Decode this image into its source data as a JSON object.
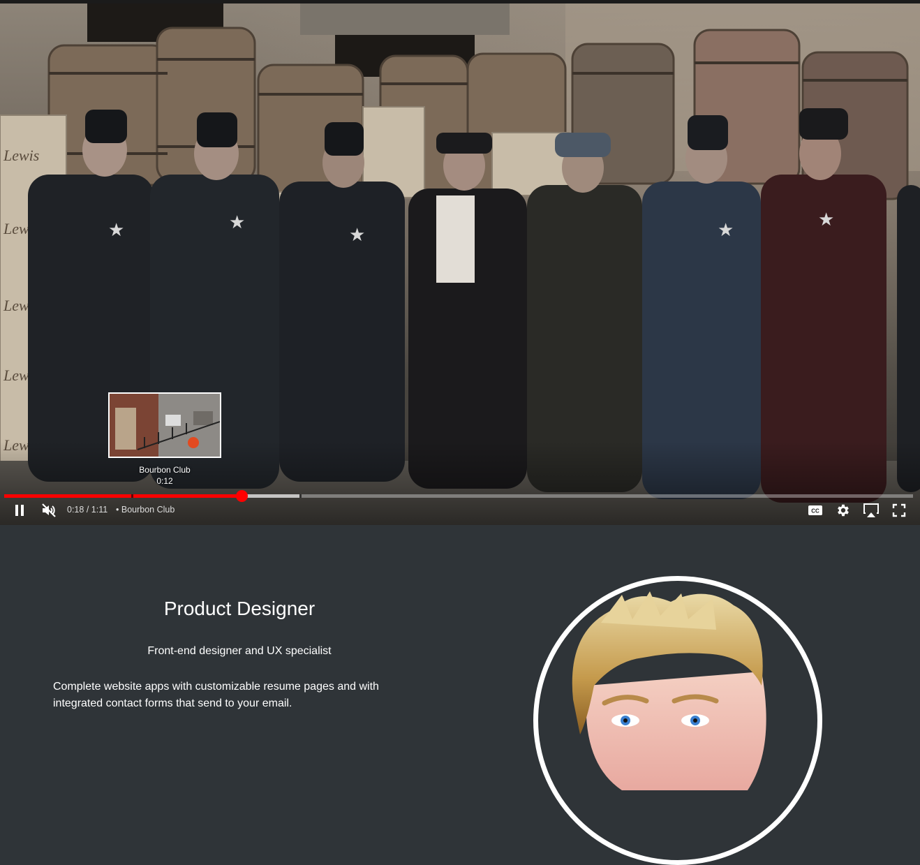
{
  "player": {
    "current_time": "0:18",
    "duration": "1:11",
    "time_separator": "/",
    "chapter_separator": "•",
    "chapter": "Bourbon Club",
    "played_fraction": 0.261,
    "buffered_fraction": 0.325,
    "chapter_marks": [
      0.14,
      0.325
    ],
    "preview": {
      "title": "Bourbon Club",
      "time": "0:12"
    },
    "colors": {
      "progress": "#ff0000"
    },
    "icons": [
      "pause-icon",
      "muted-icon",
      "cc-icon",
      "settings-icon",
      "airplay-icon",
      "fullscreen-icon"
    ]
  },
  "profile": {
    "title": "Product Designer",
    "tagline": "Front-end designer and UX specialist",
    "description": "Complete website apps with customizable resume pages and with integrated contact forms that send to your email."
  },
  "colors": {
    "background": "#2f3438",
    "text": "#ffffff"
  }
}
